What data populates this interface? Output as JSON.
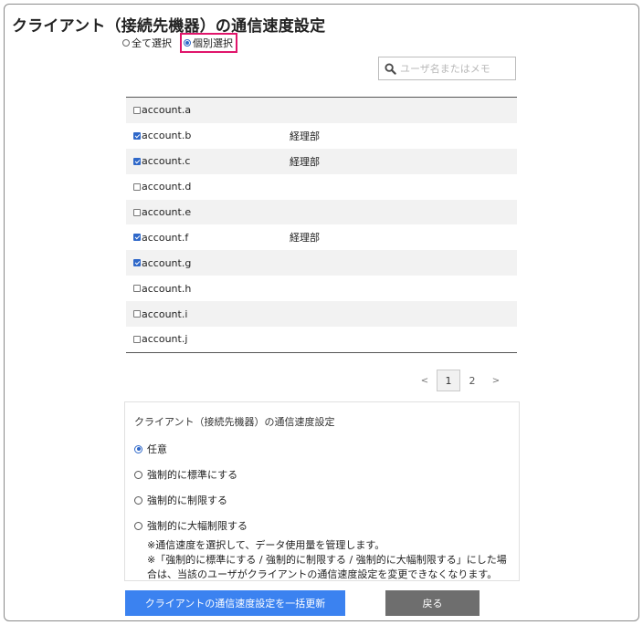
{
  "title": "クライアント（接続先機器）の通信速度設定",
  "selection_mode": {
    "all_label": "全て選択",
    "individual_label": "個別選択",
    "selected": "individual"
  },
  "search": {
    "placeholder": "ユーザ名またはメモ",
    "value": ""
  },
  "accounts": [
    {
      "name": "account.a",
      "memo": "",
      "checked": false
    },
    {
      "name": "account.b",
      "memo": "経理部",
      "checked": true
    },
    {
      "name": "account.c",
      "memo": "経理部",
      "checked": true
    },
    {
      "name": "account.d",
      "memo": "",
      "checked": false
    },
    {
      "name": "account.e",
      "memo": "",
      "checked": false
    },
    {
      "name": "account.f",
      "memo": "経理部",
      "checked": true
    },
    {
      "name": "account.g",
      "memo": "",
      "checked": true
    },
    {
      "name": "account.h",
      "memo": "",
      "checked": false
    },
    {
      "name": "account.i",
      "memo": "",
      "checked": false
    },
    {
      "name": "account.j",
      "memo": "",
      "checked": false
    }
  ],
  "pagination": {
    "prev": "<",
    "pages": [
      "1",
      "2"
    ],
    "current": "1",
    "next": ">"
  },
  "settings": {
    "heading": "クライアント（接続先機器）の通信速度設定",
    "options": [
      "任意",
      "強制的に標準にする",
      "強制的に制限する",
      "強制的に大幅制限する"
    ],
    "selected_index": 0,
    "note_line1": "※通信速度を選択して、データ使用量を管理します。",
    "note_line2": "※「強制的に標準にする / 強制的に制限する / 強制的に大幅制限する」にした場",
    "note_line3": "合は、当該のユーザがクライアントの通信速度設定を変更できなくなります。"
  },
  "buttons": {
    "update": "クライアントの通信速度設定を一括更新",
    "back": "戻る"
  },
  "colors": {
    "primary": "#3b82f0",
    "secondary": "#6e6e6e",
    "highlight": "#e0156b",
    "check": "#2f68c9"
  }
}
